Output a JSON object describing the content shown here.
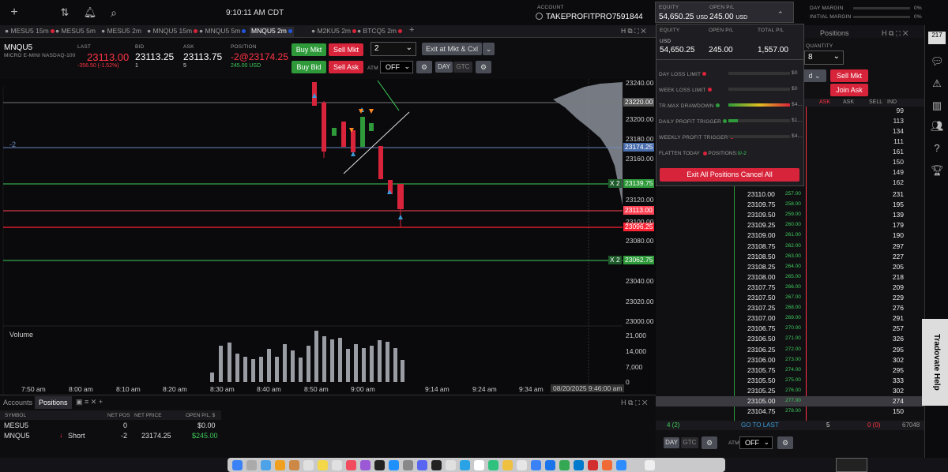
{
  "topbar": {
    "time": "9:10:11 AM CDT",
    "account_label": "ACCOUNT",
    "account_name": "TAKEPROFITPRO7591844",
    "day_margin_label": "DAY MARGIN",
    "day_margin_val": "0%",
    "init_margin_label": "INITIAL MARGIN",
    "init_margin_val": "0%",
    "equity_label": "EQUITY",
    "equity_val": "54,650.25",
    "equity_unit": "USD",
    "openpl_label": "OPEN P/L",
    "openpl_val": "245.00",
    "openpl_unit": "USD"
  },
  "tabs": [
    {
      "label": "MESU5 15m",
      "color": "#d8243a"
    },
    {
      "label": "MESU5 5m",
      "color": ""
    },
    {
      "label": "MESU5 2m",
      "color": ""
    },
    {
      "label": "MNQU5 15m",
      "color": "#d8243a"
    },
    {
      "label": "MNQU5 5m",
      "color": "#2255dd"
    },
    {
      "label": "MNQU5 2m",
      "color": "#2255dd",
      "active": true
    },
    {
      "label": "M2KU5 2m",
      "color": "#d8243a"
    },
    {
      "label": "BTCQ5 2m",
      "color": "#d8243a"
    },
    {
      "label": "+",
      "color": ""
    }
  ],
  "instrument": {
    "symbol": "MNQU5",
    "desc": "MICRO E-MINI NASDAQ-100",
    "last_label": "LAST",
    "last": "23113.00",
    "change": "-356.50 (-1.52%)",
    "bid_label": "BID",
    "bid": "23113.25",
    "bid_size": "1",
    "ask_label": "ASK",
    "ask": "23113.75",
    "ask_size": "5",
    "pos_label": "POSITION",
    "pos": "-2@23174.25",
    "pos_pl": "245.00 USD"
  },
  "order": {
    "buy_mkt": "Buy Mkt",
    "sell_mkt": "Sell Mkt",
    "qty": "2",
    "exit": "Exit at Mkt & Cxl",
    "buy_bid": "Buy Bid",
    "sell_ask": "Sell Ask",
    "atm_label": "ATM",
    "atm_val": "OFF",
    "day": "DAY",
    "gtc": "GTC"
  },
  "chart": {
    "price_ticks": [
      "23240.00",
      "23220.00",
      "23200.00",
      "23180.00",
      "23160.00",
      "23140.00",
      "23120.00",
      "23100.00",
      "23080.00",
      "23060.00",
      "23040.00",
      "23020.00",
      "23000.00"
    ],
    "time_ticks": [
      "7:50 am",
      "8:00 am",
      "8:10 am",
      "8:20 am",
      "8:30 am",
      "8:40 am",
      "8:50 am",
      "9:00 am",
      "9:14 am",
      "9:24 am",
      "9:34 am"
    ],
    "date_tag": "08/20/2025 9:46:00 am",
    "volume_label": "Volume",
    "vol_ticks": [
      "21,000",
      "14,000",
      "7,000",
      "0"
    ],
    "tags": {
      "t23220": "23220.00",
      "t23174": "23174.25",
      "t23139": "23139.75",
      "t23113": "23113.00",
      "t23096": "23096.25",
      "t23062": "23062.75"
    },
    "pos_marker": "-2",
    "x2a": "X  2",
    "x2b": "X  2"
  },
  "bottom": {
    "tab_accounts": "Accounts",
    "tab_positions": "Positions",
    "cols": [
      "SYMBOL",
      "NET POS",
      "NET PRICE",
      "OPEN P/L, $"
    ],
    "rows": [
      {
        "sym": "MESU5",
        "pos": "0",
        "price": "",
        "pl": "$0.00",
        "side": ""
      },
      {
        "sym": "MNQU5",
        "pos": "-2",
        "price": "23174.25",
        "pl": "$245.00",
        "side": "Short"
      }
    ]
  },
  "popup": {
    "equity_label": "EQUITY",
    "openpl_label": "OPEN P/L",
    "totalpl_label": "TOTAL P/L",
    "usd": "USD",
    "equity": "54,650.25",
    "openpl": "245.00",
    "totalpl": "1,557.00",
    "rows": [
      {
        "label": "DAY LOSS LIMIT",
        "color": "#d8243a",
        "val": "$0"
      },
      {
        "label": "WEEK LOSS LIMIT",
        "color": "#d8243a",
        "val": "$0"
      },
      {
        "label": "TR.MAX DRAWDOWN",
        "color": "#2e9a3a",
        "val": "$4..."
      },
      {
        "label": "DAILY PROFIT TRIGGER",
        "color": "#2e9a3a",
        "val": "$1..."
      },
      {
        "label": "WEEKLY PROFIT TRIGGER",
        "color": "#d8243a",
        "val": "$4..."
      }
    ],
    "flatten": "FLATTEN TODAY",
    "positions": "POSITIONS:",
    "pos_val": "0/-2",
    "exit_all": "Exit All Positions Cancel All"
  },
  "dom": {
    "header_tab": "Positions",
    "qty_label": "QUANTITY",
    "qty": "8",
    "sell_mkt": "Sell Mkt",
    "join_ask": "Join Ask",
    "cols": [
      "ASK",
      "ASK",
      "SELL",
      "IND"
    ],
    "right_top": [
      "99",
      "113",
      "134",
      "111",
      "161",
      "150",
      "149",
      "162"
    ],
    "rows": [
      [
        "23110.00",
        "257.00",
        "231"
      ],
      [
        "23109.75",
        "258.00",
        "195"
      ],
      [
        "23109.50",
        "259.00",
        "139"
      ],
      [
        "23109.25",
        "260.00",
        "179"
      ],
      [
        "23109.00",
        "261.00",
        "190"
      ],
      [
        "23108.75",
        "262.00",
        "297"
      ],
      [
        "23108.50",
        "263.00",
        "227"
      ],
      [
        "23108.25",
        "264.00",
        "205"
      ],
      [
        "23108.00",
        "265.00",
        "218"
      ],
      [
        "23107.75",
        "266.00",
        "209"
      ],
      [
        "23107.50",
        "267.00",
        "229"
      ],
      [
        "23107.25",
        "268.00",
        "276"
      ],
      [
        "23107.00",
        "269.00",
        "291"
      ],
      [
        "23106.75",
        "270.00",
        "257"
      ],
      [
        "23106.50",
        "271.00",
        "326"
      ],
      [
        "23106.25",
        "272.00",
        "295"
      ],
      [
        "23106.00",
        "273.00",
        "302"
      ],
      [
        "23105.75",
        "274.00",
        "295"
      ],
      [
        "23105.50",
        "275.00",
        "333"
      ],
      [
        "23105.25",
        "276.00",
        "302"
      ],
      [
        "23105.00",
        "277.00",
        "274"
      ],
      [
        "23104.75",
        "278.00",
        "150"
      ]
    ],
    "footer": [
      "4 (2)",
      "GO TO LAST",
      "5",
      "0 (0)",
      "67048"
    ],
    "day": "DAY",
    "gtc": "GTC",
    "atm": "ATM",
    "atm_val": "OFF"
  },
  "help": "Tradovate Help"
}
